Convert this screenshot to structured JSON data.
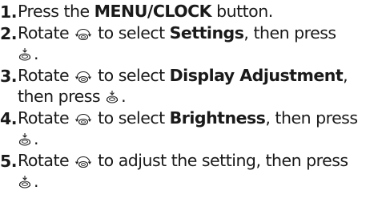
{
  "steps": [
    {
      "number": "1.",
      "text": {
        "a": "Press the ",
        "b": "MENU/CLOCK",
        "c": " button."
      }
    },
    {
      "number": "2.",
      "text": {
        "a": "Rotate",
        "b": "to select ",
        "c": "Settings",
        "d": ", then press",
        "e": "."
      }
    },
    {
      "number": "3.",
      "text": {
        "a": "Rotate",
        "b": "to select ",
        "c": "Display Adjustment",
        "d": ",",
        "e": "then press ",
        "f": "."
      }
    },
    {
      "number": "4.",
      "text": {
        "a": "Rotate",
        "b": "to select ",
        "c": "Brightness",
        "d": ", then press",
        "e": "."
      }
    },
    {
      "number": "5.",
      "text": {
        "a": "Rotate",
        "b": "to adjust the setting, then press",
        "c": "."
      }
    }
  ],
  "icons": {
    "rotate": "selector-knob-rotate-icon",
    "press": "selector-knob-press-icon"
  }
}
